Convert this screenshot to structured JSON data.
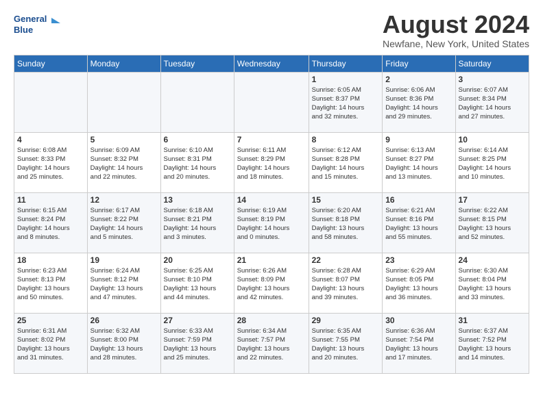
{
  "logo": {
    "line1": "General",
    "line2": "Blue"
  },
  "title": {
    "month_year": "August 2024",
    "location": "Newfane, New York, United States"
  },
  "days_of_week": [
    "Sunday",
    "Monday",
    "Tuesday",
    "Wednesday",
    "Thursday",
    "Friday",
    "Saturday"
  ],
  "weeks": [
    [
      {
        "day": "",
        "info": ""
      },
      {
        "day": "",
        "info": ""
      },
      {
        "day": "",
        "info": ""
      },
      {
        "day": "",
        "info": ""
      },
      {
        "day": "1",
        "info": "Sunrise: 6:05 AM\nSunset: 8:37 PM\nDaylight: 14 hours\nand 32 minutes."
      },
      {
        "day": "2",
        "info": "Sunrise: 6:06 AM\nSunset: 8:36 PM\nDaylight: 14 hours\nand 29 minutes."
      },
      {
        "day": "3",
        "info": "Sunrise: 6:07 AM\nSunset: 8:34 PM\nDaylight: 14 hours\nand 27 minutes."
      }
    ],
    [
      {
        "day": "4",
        "info": "Sunrise: 6:08 AM\nSunset: 8:33 PM\nDaylight: 14 hours\nand 25 minutes."
      },
      {
        "day": "5",
        "info": "Sunrise: 6:09 AM\nSunset: 8:32 PM\nDaylight: 14 hours\nand 22 minutes."
      },
      {
        "day": "6",
        "info": "Sunrise: 6:10 AM\nSunset: 8:31 PM\nDaylight: 14 hours\nand 20 minutes."
      },
      {
        "day": "7",
        "info": "Sunrise: 6:11 AM\nSunset: 8:29 PM\nDaylight: 14 hours\nand 18 minutes."
      },
      {
        "day": "8",
        "info": "Sunrise: 6:12 AM\nSunset: 8:28 PM\nDaylight: 14 hours\nand 15 minutes."
      },
      {
        "day": "9",
        "info": "Sunrise: 6:13 AM\nSunset: 8:27 PM\nDaylight: 14 hours\nand 13 minutes."
      },
      {
        "day": "10",
        "info": "Sunrise: 6:14 AM\nSunset: 8:25 PM\nDaylight: 14 hours\nand 10 minutes."
      }
    ],
    [
      {
        "day": "11",
        "info": "Sunrise: 6:15 AM\nSunset: 8:24 PM\nDaylight: 14 hours\nand 8 minutes."
      },
      {
        "day": "12",
        "info": "Sunrise: 6:17 AM\nSunset: 8:22 PM\nDaylight: 14 hours\nand 5 minutes."
      },
      {
        "day": "13",
        "info": "Sunrise: 6:18 AM\nSunset: 8:21 PM\nDaylight: 14 hours\nand 3 minutes."
      },
      {
        "day": "14",
        "info": "Sunrise: 6:19 AM\nSunset: 8:19 PM\nDaylight: 14 hours\nand 0 minutes."
      },
      {
        "day": "15",
        "info": "Sunrise: 6:20 AM\nSunset: 8:18 PM\nDaylight: 13 hours\nand 58 minutes."
      },
      {
        "day": "16",
        "info": "Sunrise: 6:21 AM\nSunset: 8:16 PM\nDaylight: 13 hours\nand 55 minutes."
      },
      {
        "day": "17",
        "info": "Sunrise: 6:22 AM\nSunset: 8:15 PM\nDaylight: 13 hours\nand 52 minutes."
      }
    ],
    [
      {
        "day": "18",
        "info": "Sunrise: 6:23 AM\nSunset: 8:13 PM\nDaylight: 13 hours\nand 50 minutes."
      },
      {
        "day": "19",
        "info": "Sunrise: 6:24 AM\nSunset: 8:12 PM\nDaylight: 13 hours\nand 47 minutes."
      },
      {
        "day": "20",
        "info": "Sunrise: 6:25 AM\nSunset: 8:10 PM\nDaylight: 13 hours\nand 44 minutes."
      },
      {
        "day": "21",
        "info": "Sunrise: 6:26 AM\nSunset: 8:09 PM\nDaylight: 13 hours\nand 42 minutes."
      },
      {
        "day": "22",
        "info": "Sunrise: 6:28 AM\nSunset: 8:07 PM\nDaylight: 13 hours\nand 39 minutes."
      },
      {
        "day": "23",
        "info": "Sunrise: 6:29 AM\nSunset: 8:05 PM\nDaylight: 13 hours\nand 36 minutes."
      },
      {
        "day": "24",
        "info": "Sunrise: 6:30 AM\nSunset: 8:04 PM\nDaylight: 13 hours\nand 33 minutes."
      }
    ],
    [
      {
        "day": "25",
        "info": "Sunrise: 6:31 AM\nSunset: 8:02 PM\nDaylight: 13 hours\nand 31 minutes."
      },
      {
        "day": "26",
        "info": "Sunrise: 6:32 AM\nSunset: 8:00 PM\nDaylight: 13 hours\nand 28 minutes."
      },
      {
        "day": "27",
        "info": "Sunrise: 6:33 AM\nSunset: 7:59 PM\nDaylight: 13 hours\nand 25 minutes."
      },
      {
        "day": "28",
        "info": "Sunrise: 6:34 AM\nSunset: 7:57 PM\nDaylight: 13 hours\nand 22 minutes."
      },
      {
        "day": "29",
        "info": "Sunrise: 6:35 AM\nSunset: 7:55 PM\nDaylight: 13 hours\nand 20 minutes."
      },
      {
        "day": "30",
        "info": "Sunrise: 6:36 AM\nSunset: 7:54 PM\nDaylight: 13 hours\nand 17 minutes."
      },
      {
        "day": "31",
        "info": "Sunrise: 6:37 AM\nSunset: 7:52 PM\nDaylight: 13 hours\nand 14 minutes."
      }
    ]
  ]
}
